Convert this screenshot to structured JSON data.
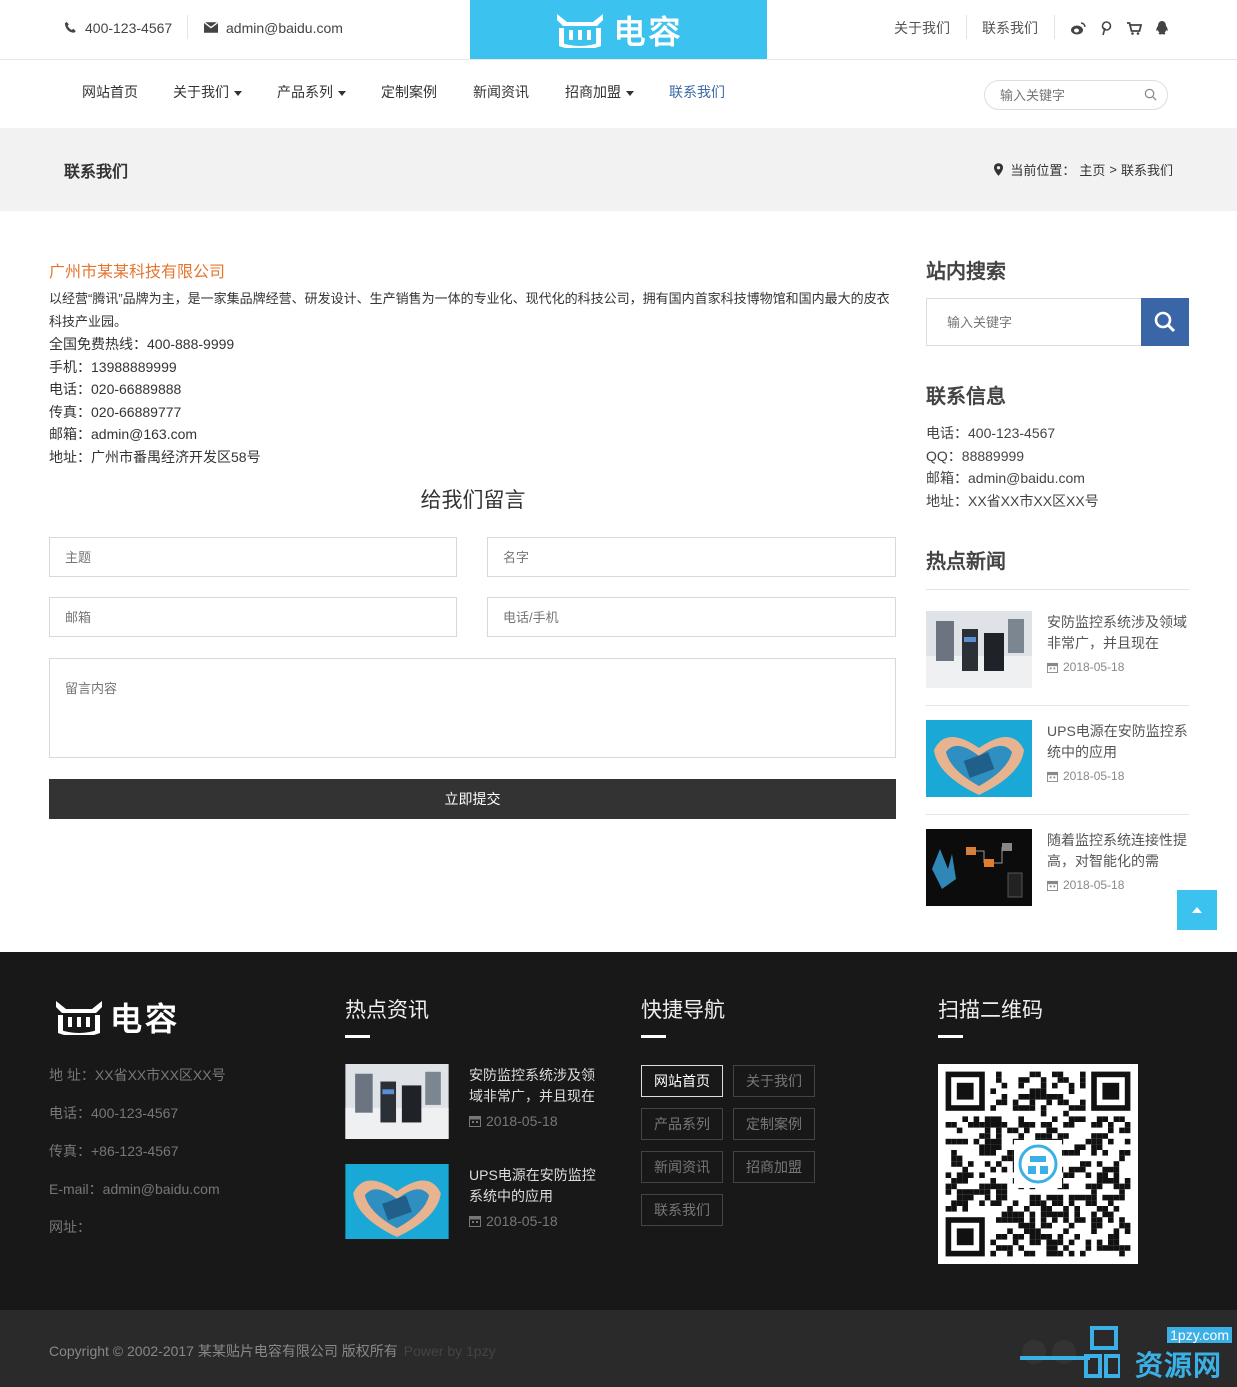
{
  "topbar": {
    "phone": "400-123-4567",
    "email": "admin@baidu.com",
    "logo_text": "电容",
    "links": [
      "关于我们",
      "联系我们"
    ],
    "icons": [
      "weibo-icon",
      "pinterest-icon",
      "cart-icon",
      "qq-icon"
    ]
  },
  "nav": {
    "items": [
      {
        "label": "网站首页",
        "dropdown": false
      },
      {
        "label": "关于我们",
        "dropdown": true
      },
      {
        "label": "产品系列",
        "dropdown": true
      },
      {
        "label": "定制案例",
        "dropdown": false
      },
      {
        "label": "新闻资讯",
        "dropdown": false
      },
      {
        "label": "招商加盟",
        "dropdown": true
      },
      {
        "label": "联系我们",
        "dropdown": false,
        "active": true
      }
    ],
    "search_placeholder": "输入关键字"
  },
  "banner": {
    "title": "联系我们",
    "crumb_label": "当前位置：",
    "crumb_home": "主页",
    "crumb_sep": ">",
    "crumb_current": "联系我们"
  },
  "contact": {
    "company": "广州市某某科技有限公司",
    "intro": "以经营“腾讯”品牌为主，是一家集品牌经营、研发设计、生产销售为一体的专业化、现代化的科技公司，拥有国内首家科技博物馆和国内最大的皮衣科技产业园。",
    "lines": [
      "全国免费热线：400-888-9999",
      "手机：13988889999",
      "电话：020-66889888",
      "传真：020-66889777",
      "邮箱：admin@163.com",
      "地址：广州市番禺经济开发区58号"
    ]
  },
  "form": {
    "title": "给我们留言",
    "subject_placeholder": "主题",
    "name_placeholder": "名字",
    "email_placeholder": "邮箱",
    "phone_placeholder": "电话/手机",
    "message_placeholder": "留言内容",
    "submit_label": "立即提交"
  },
  "sidebar": {
    "search_title": "站内搜索",
    "search_placeholder": "输入关键字",
    "info_title": "联系信息",
    "info_lines": [
      "电话：400-123-4567",
      "QQ：88889999",
      "邮箱：admin@baidu.com",
      "地址：XX省XX市XX区XX号"
    ],
    "news_title": "热点新闻",
    "news": [
      {
        "title": "安防监控系统涉及领域非常广，并且现在",
        "date": "2018-05-18"
      },
      {
        "title": "UPS电源在安防监控系统中的应用",
        "date": "2018-05-18"
      },
      {
        "title": "随着监控系统连接性提高，对智能化的需",
        "date": "2018-05-18"
      }
    ]
  },
  "footer": {
    "logo_text": "电容",
    "info_lines": [
      "地 址：XX省XX市XX区XX号",
      "电话：400-123-4567",
      "传真：+86-123-4567",
      "E-mail：admin@baidu.com",
      "网址："
    ],
    "news_title": "热点资讯",
    "news": [
      {
        "title": "安防监控系统涉及领域非常广，并且现在",
        "date": "2018-05-18"
      },
      {
        "title": "UPS电源在安防监控系统中的应用",
        "date": "2018-05-18"
      }
    ],
    "nav_title": "快捷导航",
    "nav_links": [
      "网站首页",
      "关于我们",
      "产品系列",
      "定制案例",
      "新闻资讯",
      "招商加盟",
      "联系我们"
    ],
    "qr_title": "扫描二维码"
  },
  "copyright": {
    "text": "Copyright © 2002-2017 某某贴片电容有限公司 版权所有",
    "powered": "Power by 1pzy",
    "watermark_url": "1pzy.com",
    "watermark_text": "资源网"
  },
  "colors": {
    "accent": "#3bc2ee",
    "nav_active": "#3a6aa6",
    "company": "#e5752f",
    "search_btn": "#3a66a8",
    "footer_bg": "#181818"
  }
}
